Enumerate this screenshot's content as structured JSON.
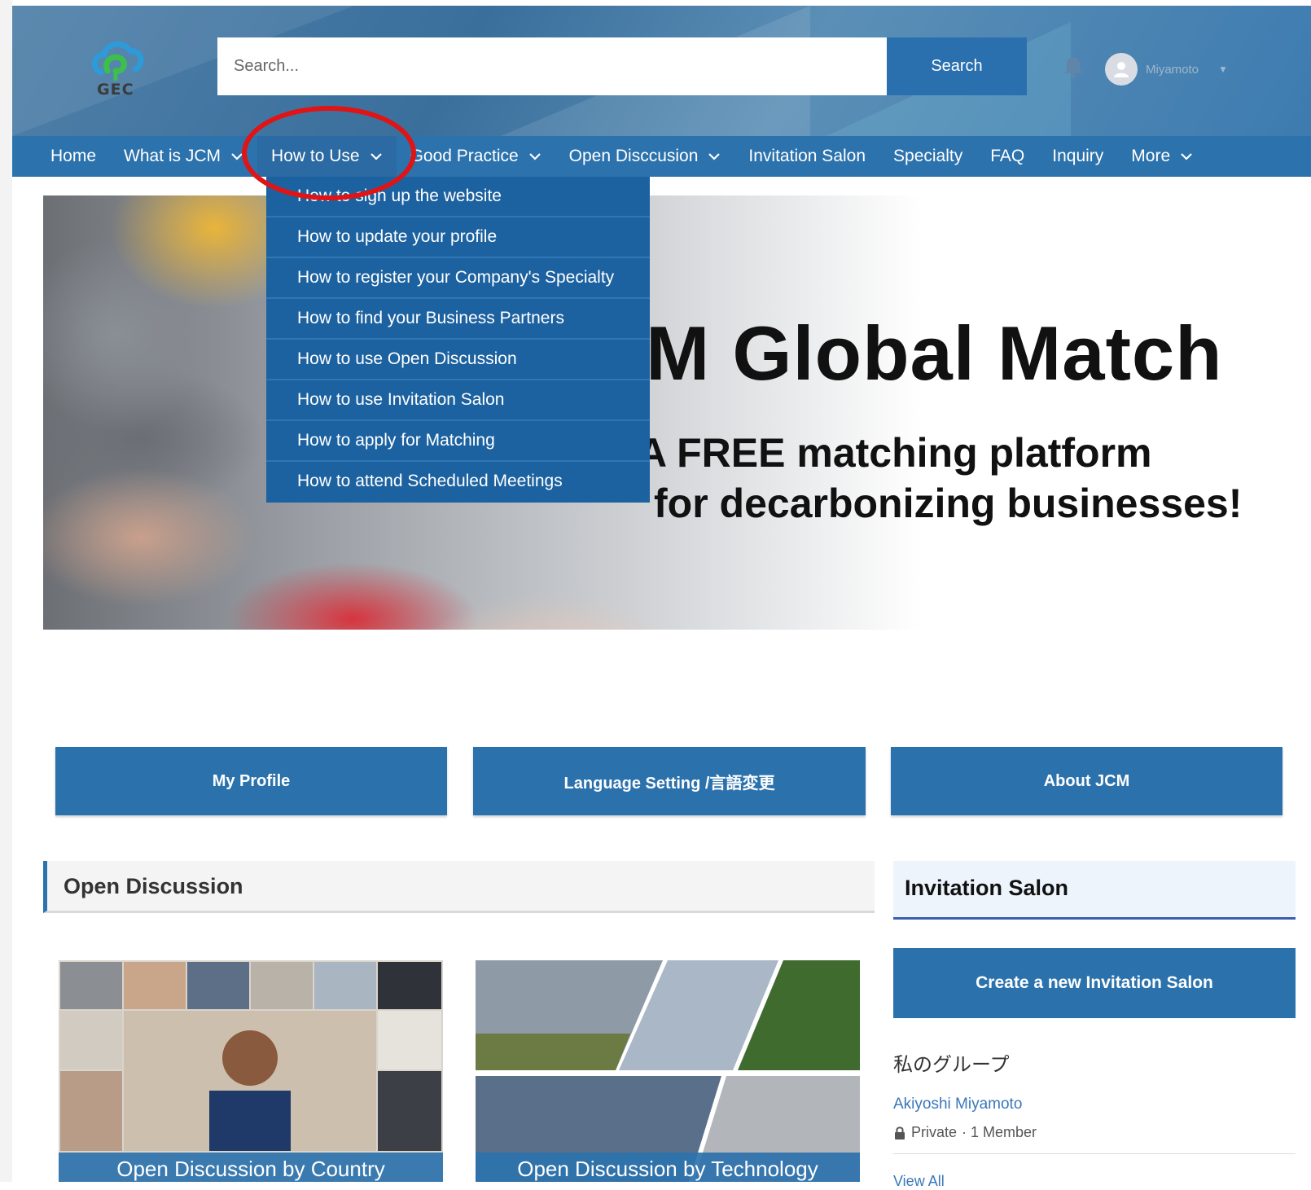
{
  "header": {
    "logo_text": "GEC",
    "search_placeholder": "Search...",
    "search_button": "Search",
    "user_name": "Miyamoto"
  },
  "nav": {
    "items": [
      {
        "label": "Home"
      },
      {
        "label": "What is JCM"
      },
      {
        "label": "How to Use"
      },
      {
        "label": "Good Practice"
      },
      {
        "label": "Open Disccusion"
      },
      {
        "label": "Invitation Salon"
      },
      {
        "label": "Specialty"
      },
      {
        "label": "FAQ"
      },
      {
        "label": "Inquiry"
      },
      {
        "label": "More"
      }
    ]
  },
  "dropdown": {
    "items": [
      "How to sign up the website",
      "How to update your profile",
      "How to register your Company's Specialty",
      "How to find your Business Partners",
      "How to use Open Discussion",
      "How to use Invitation Salon",
      "How to apply for Matching",
      "How to attend Scheduled Meetings"
    ]
  },
  "hero": {
    "title": "M Global Match",
    "subtitle_line1": "A FREE matching platform",
    "subtitle_line2": "for decarbonizing businesses!"
  },
  "actions": {
    "my_profile": "My Profile",
    "language": "Language Setting /言語変更",
    "about": "About JCM"
  },
  "open_discussion": {
    "title": "Open Discussion",
    "cards": [
      {
        "caption": "Open Discussion by Country"
      },
      {
        "caption": "Open Discussion by Technology"
      }
    ]
  },
  "invitation_salon": {
    "title": "Invitation Salon",
    "create_button": "Create a new Invitation Salon",
    "my_groups": "私のグループ",
    "group_name": "Akiyoshi Miyamoto",
    "group_privacy": "Private",
    "group_members": "· 1 Member",
    "view_all": "View All"
  },
  "colors": {
    "primary": "#2c72ad",
    "dropdown_bg": "#1d62a0",
    "annotation": "#e01414"
  }
}
